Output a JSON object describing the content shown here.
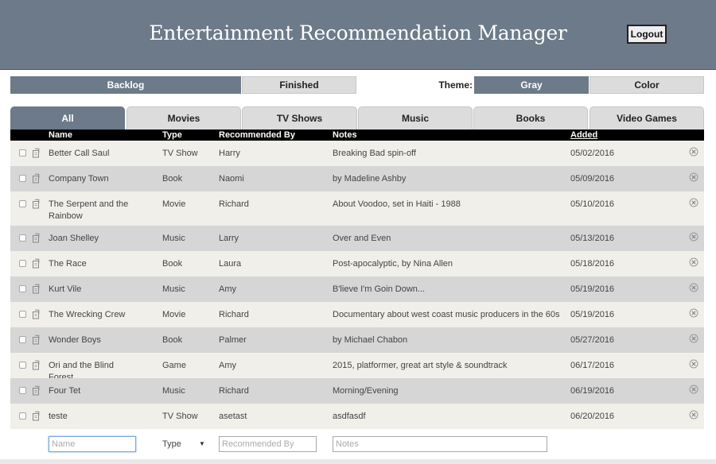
{
  "header": {
    "title": "Entertainment Recommendation Manager",
    "logout_label": "Logout"
  },
  "list_toggle": {
    "backlog_label": "Backlog",
    "finished_label": "Finished",
    "active": "Backlog"
  },
  "theme": {
    "label": "Theme:",
    "gray_label": "Gray",
    "color_label": "Color",
    "active": "Gray"
  },
  "tabs": [
    {
      "label": "All",
      "active": true
    },
    {
      "label": "Movies",
      "active": false
    },
    {
      "label": "TV Shows",
      "active": false
    },
    {
      "label": "Music",
      "active": false
    },
    {
      "label": "Books",
      "active": false
    },
    {
      "label": "Video Games",
      "active": false
    }
  ],
  "table": {
    "columns": {
      "name": "Name",
      "type": "Type",
      "recommended_by": "Recommended By",
      "notes": "Notes",
      "added": "Added"
    },
    "rows": [
      {
        "name": "Better Call Saul",
        "type": "TV Show",
        "recommended_by": "Harry",
        "notes": "Breaking Bad spin-off",
        "added": "05/02/2016"
      },
      {
        "name": "Company Town",
        "type": "Book",
        "recommended_by": "Naomi",
        "notes": "by Madeline Ashby",
        "added": "05/09/2016"
      },
      {
        "name": "The Serpent and the Rainbow",
        "type": "Movie",
        "recommended_by": "Richard",
        "notes": "About Voodoo, set in Haiti - 1988",
        "added": "05/10/2016"
      },
      {
        "name": "Joan Shelley",
        "type": "Music",
        "recommended_by": "Larry",
        "notes": "Over and Even",
        "added": "05/13/2016"
      },
      {
        "name": "The Race",
        "type": "Book",
        "recommended_by": "Laura",
        "notes": "Post-apocalyptic, by Nina Allen",
        "added": "05/18/2016"
      },
      {
        "name": "Kurt Vile",
        "type": "Music",
        "recommended_by": "Amy",
        "notes": "B'lieve I'm Goin Down...",
        "added": "05/19/2016"
      },
      {
        "name": "The Wrecking Crew",
        "type": "Movie",
        "recommended_by": "Richard",
        "notes": "Documentary about west coast music producers in the 60s",
        "added": "05/19/2016"
      },
      {
        "name": "Wonder Boys",
        "type": "Book",
        "recommended_by": "Palmer",
        "notes": "by Michael Chabon",
        "added": "05/27/2016"
      },
      {
        "name": "Ori and the Blind Forest",
        "type": "Game",
        "recommended_by": "Amy",
        "notes": "2015, platformer, great art style & soundtrack",
        "added": "06/17/2016"
      },
      {
        "name": "Four Tet",
        "type": "Music",
        "recommended_by": "Richard",
        "notes": "Morning/Evening",
        "added": "06/19/2016"
      },
      {
        "name": "teste",
        "type": "TV Show",
        "recommended_by": "asetast",
        "notes": "asdfasdf",
        "added": "06/20/2016"
      }
    ]
  },
  "add_form": {
    "name_placeholder": "Name",
    "type_value": "Type",
    "recommended_by_placeholder": "Recommended By",
    "notes_placeholder": "Notes"
  },
  "icons": {
    "row_checkbox": "checkbox-icon",
    "row_edit": "edit-icon",
    "row_delete": "delete-x-icon"
  },
  "colors": {
    "accent": "#6c7a89",
    "row_light": "#f1efe9",
    "row_dark": "#d6d6d6",
    "inactive_tab": "#dcdcdc"
  }
}
